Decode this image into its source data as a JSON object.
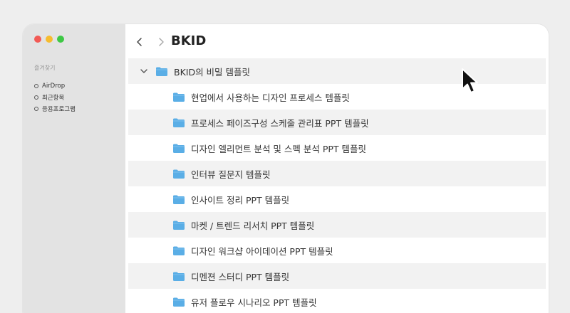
{
  "sidebar": {
    "favorites_title": "즐겨찾기",
    "items": [
      {
        "label": "AirDrop"
      },
      {
        "label": "최근항목"
      },
      {
        "label": "응용프로그램"
      }
    ]
  },
  "toolbar": {
    "title": "BKID"
  },
  "folder_tree": {
    "parent": {
      "name": "BKID의 비밀 템플릿"
    },
    "children": [
      {
        "name": "현업에서 사용하는 디자인 프로세스 템플릿"
      },
      {
        "name": "프로세스 페이즈구성 스케줄 관리표 PPT 템플릿"
      },
      {
        "name": "디자인 엘리먼트 분석 및 스펙 분석 PPT 템플릿"
      },
      {
        "name": "인터뷰 질문지 템플릿"
      },
      {
        "name": "인사이트 정리 PPT 템플릿"
      },
      {
        "name": "마켓 / 트렌드 리서치 PPT 템플릿"
      },
      {
        "name": "디자인 워크샵 아이데이션 PPT 템플릿"
      },
      {
        "name": "디멘젼 스터디 PPT 템플릿"
      },
      {
        "name": "유저 플로우 시나리오 PPT 템플릿"
      }
    ]
  },
  "colors": {
    "folder": "#5aaee6",
    "sidebar_bg": "#e3e3e3",
    "row_shade": "#f2f2f2",
    "close": "#f25a55",
    "minimize": "#f6bc2f",
    "zoom": "#3ec845"
  },
  "icons": {
    "back": "chevron-left-icon",
    "forward": "chevron-right-icon",
    "expand": "chevron-down-icon",
    "folder": "folder-icon",
    "pointer": "mouse-cursor-icon"
  }
}
